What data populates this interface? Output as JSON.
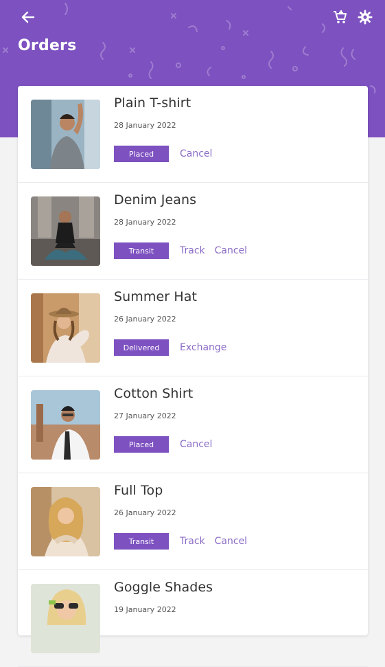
{
  "header": {
    "title": "Orders",
    "back_icon": "arrow-left-icon",
    "cart_icon": "add-to-cart-icon",
    "settings_icon": "gear-icon",
    "background_color": "#7d51c0"
  },
  "orders": [
    {
      "name": "Plain T-shirt",
      "date": "28 January 2022",
      "status": "Placed",
      "actions": [
        "Cancel"
      ],
      "thumb_color": "#8aa4b8"
    },
    {
      "name": "Denim Jeans",
      "date": "28 January 2022",
      "status": "Transit",
      "actions": [
        "Track",
        "Cancel"
      ],
      "thumb_color": "#6f6a64"
    },
    {
      "name": "Summer Hat",
      "date": "26 January 2022",
      "status": "Delivered",
      "actions": [
        "Exchange"
      ],
      "thumb_color": "#c8925a"
    },
    {
      "name": "Cotton Shirt",
      "date": "27 January 2022",
      "status": "Placed",
      "actions": [
        "Cancel"
      ],
      "thumb_color": "#9ab6c8"
    },
    {
      "name": "Full Top",
      "date": "26 January 2022",
      "status": "Transit",
      "actions": [
        "Track",
        "Cancel"
      ],
      "thumb_color": "#d8b48a"
    },
    {
      "name": "Goggle Shades",
      "date": "19 January 2022",
      "status": "",
      "actions": [],
      "thumb_color": "#c9d3c0"
    }
  ],
  "colors": {
    "accent": "#7d51c0",
    "link": "#8a6bc6"
  }
}
